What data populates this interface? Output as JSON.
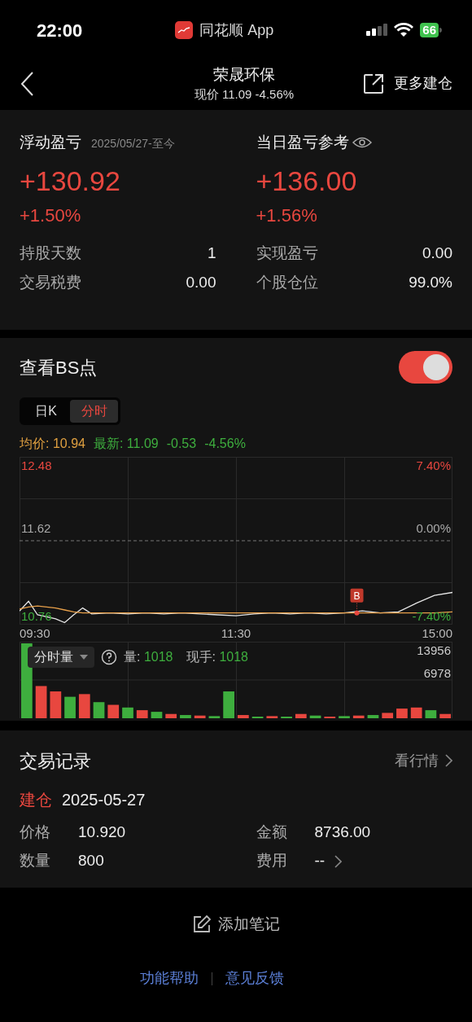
{
  "status_bar": {
    "time": "22:00",
    "app": "同花顺 App",
    "battery": "66"
  },
  "header": {
    "title": "荣晟环保",
    "subtitle": "现价 11.09 -4.56%",
    "action": "更多建仓"
  },
  "pnl": {
    "left": {
      "label": "浮动盈亏",
      "date": "2025/05/27-至今",
      "value": "+130.92",
      "percent": "+1.50%"
    },
    "right": {
      "label": "当日盈亏参考",
      "value": "+136.00",
      "percent": "+1.56%"
    },
    "stats": [
      {
        "label": "持股天数",
        "value": "1"
      },
      {
        "label": "实现盈亏",
        "value": "0.00"
      },
      {
        "label": "交易税费",
        "value": "0.00"
      },
      {
        "label": "个股仓位",
        "value": "99.0%"
      }
    ]
  },
  "bs": {
    "title": "查看BS点",
    "on": true,
    "tabs": [
      {
        "label": "日K",
        "selected": false
      },
      {
        "label": "分时",
        "selected": true
      }
    ],
    "info": {
      "avg": "均价: 10.94",
      "latest": "最新: 11.09",
      "change": "-0.53",
      "percent": "-4.56%"
    },
    "price_chart": {
      "kind": "picture",
      "price_labels": [
        "12.48",
        "11.62",
        "10.76"
      ],
      "percent_labels": [
        "7.40%",
        "0.00%",
        "-7.40%"
      ],
      "time_labels": [
        "09:30",
        "11:30",
        "15:00"
      ],
      "marker": "B"
    },
    "volume": {
      "selector": "分时量",
      "vol_label": "量:",
      "vol": "1018",
      "now_label": "现手:",
      "now": "1018",
      "axis_labels": [
        "13956",
        "6978"
      ]
    }
  },
  "records": {
    "title": "交易记录",
    "link": "看行情",
    "type": "建仓",
    "date": "2025-05-27",
    "fields": [
      {
        "label": "价格",
        "value": "10.920"
      },
      {
        "label": "金额",
        "value": "8736.00"
      },
      {
        "label": "数量",
        "value": "800"
      },
      {
        "label": "费用",
        "value": "--",
        "link": true
      }
    ]
  },
  "note": "添加笔记",
  "footer_links": [
    "功能帮助",
    "意见反馈"
  ]
}
